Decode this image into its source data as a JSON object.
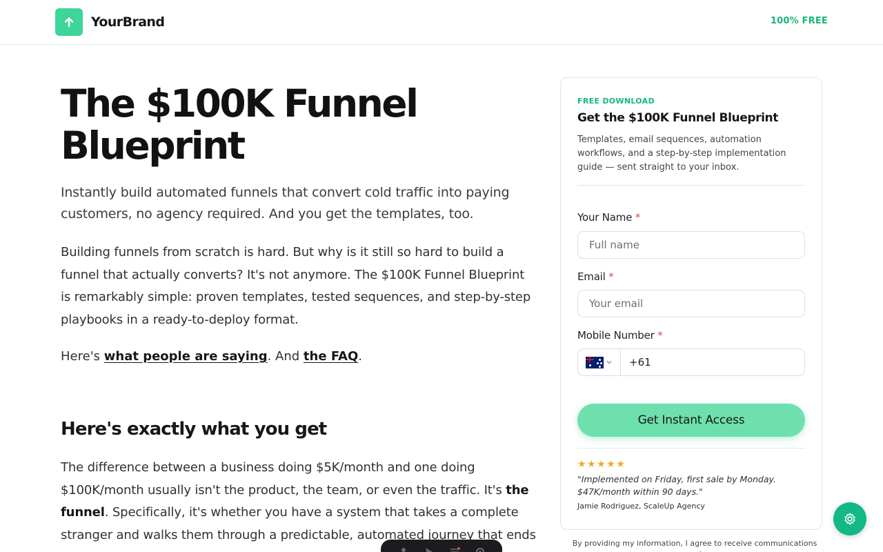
{
  "header": {
    "brand_name": "YourBrand",
    "brand_icon": "arrow-up-icon",
    "free_tag": "100% FREE"
  },
  "hero": {
    "title": "The $100K Funnel Blueprint",
    "subtitle": "Instantly build automated funnels that convert cold traffic into paying customers, no agency required. And you get the templates, too.",
    "body": "Building funnels from scratch is hard. But why is it still so hard to build a funnel that actually converts? It's not anymore. The $100K Funnel Blueprint is remarkably simple: proven templates, tested sequences, and step-by-step playbooks in a ready-to-deploy format.",
    "links_prefix": "Here's ",
    "link_testimonials": "what people are saying",
    "links_middle": ". And ",
    "link_faq": "the FAQ",
    "links_suffix": "."
  },
  "section": {
    "heading": "Here's exactly what you get",
    "p_part1": "The difference between a business doing $5K/month and one doing $100K/month usually isn't the product, the team, or even the traffic. It's ",
    "p_bold": "the funnel",
    "p_part2": ". Specifically, it's whether you have a system that takes a complete stranger and walks them through a predictable, automated journey that ends"
  },
  "form": {
    "eyebrow": "FREE DOWNLOAD",
    "title": "Get the $100K Funnel Blueprint",
    "description": "Templates, email sequences, automation workflows, and a step-by-step implementation guide — sent straight to your inbox.",
    "name_label": "Your Name",
    "name_placeholder": "Full name",
    "email_label": "Email",
    "email_placeholder": "Your email",
    "mobile_label": "Mobile Number",
    "phone_value": "+61",
    "required_mark": "*",
    "country_flag": "australia-flag-icon",
    "cta_label": "Get Instant Access",
    "rating_stars": "★★★★★",
    "rating": 5,
    "quote": "\"Implemented on Friday, first sale by Monday. $47K/month within 90 days.\"",
    "author": "Jamie Rodriguez, ScaleUp Agency"
  },
  "consent": "By providing my information, I agree to receive communications and",
  "colors": {
    "brand_green": "#3ed598",
    "accent_green": "#17b877",
    "cta_green": "#6ee0ad",
    "floating_button": "#12b886",
    "required_red": "#e5484d",
    "star_gold": "#f5a623"
  },
  "floating": {
    "settings_icon": "gear-icon",
    "toolbar_icons": [
      "person-icon",
      "cursor-icon",
      "list-icon",
      "settings-icon"
    ]
  }
}
